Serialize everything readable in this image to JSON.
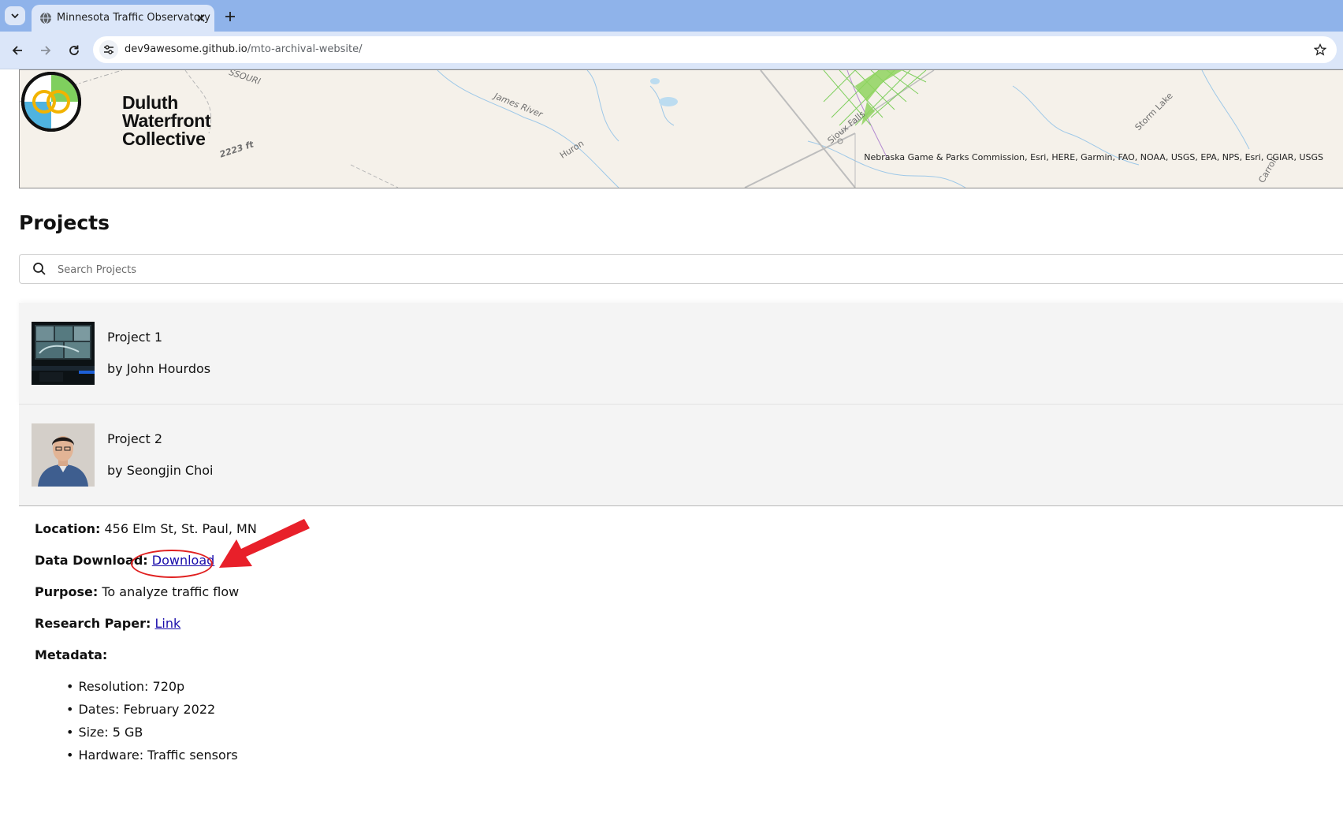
{
  "browser": {
    "tab_title": "Minnesota Traffic Observatory",
    "url_host": "dev9awesome.github.io",
    "url_path": "/mto-archival-website/"
  },
  "banner": {
    "logo_line1": "Duluth",
    "logo_line2": "Waterfront",
    "logo_line3": "Collective",
    "attribution": "Nebraska Game & Parks Commission, Esri, HERE, Garmin, FAO, NOAA, USGS, EPA, NPS, Esri, CGIAR, USGS",
    "map_labels": [
      "James River",
      "Huron",
      "Sioux Falls",
      "Storm Lake",
      "Carroll",
      "2223 ft",
      "SSOURI"
    ]
  },
  "projects": {
    "heading": "Projects",
    "search_placeholder": "Search Projects",
    "items": [
      {
        "title": "Project 1",
        "author": "by John Hourdos"
      },
      {
        "title": "Project 2",
        "author": "by Seongjin Choi"
      }
    ]
  },
  "details": {
    "location_label": "Location:",
    "location_value": "456 Elm St, St. Paul, MN",
    "download_label": "Data Download:",
    "download_link": "Download",
    "purpose_label": "Purpose:",
    "purpose_value": "To analyze traffic flow",
    "paper_label": "Research Paper:",
    "paper_link": "Link",
    "metadata_label": "Metadata:",
    "metadata": [
      "Resolution: 720p",
      "Dates: February 2022",
      "Size: 5 GB",
      "Hardware: Traffic sensors"
    ]
  },
  "colors": {
    "tabstrip": "#8fb3ea",
    "toolbar": "#dbe6f9",
    "link": "#1a0dab",
    "annotation": "#e02020"
  }
}
